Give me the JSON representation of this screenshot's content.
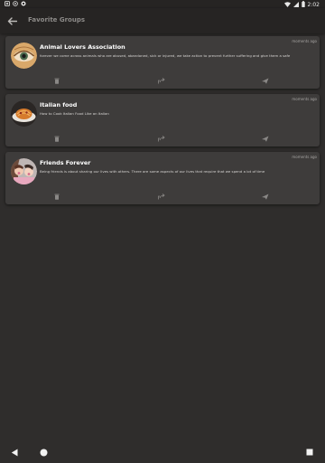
{
  "status_bar": {
    "time": "2:02",
    "left_icons": [
      "notification-x-icon",
      "settings-notification-icon",
      "circle-notification-icon"
    ],
    "right_icons": [
      "wifi-icon",
      "signal-icon",
      "battery-icon"
    ]
  },
  "app_bar": {
    "back_icon": "arrow-back-icon",
    "title": "Favorite Groups"
  },
  "groups": [
    {
      "title": "Animal Lovers Association",
      "description": "forever we come across animals who are abused, abandoned, sick or injured, we take action to prevent further suffering and give them a safe",
      "time": "moments ago",
      "avatar": "eye-avatar"
    },
    {
      "title": "Italian food",
      "description": "How to Cook Italian Food Like an Italian",
      "time": "moments ago",
      "avatar": "food-avatar"
    },
    {
      "title": "Friends Forever",
      "description": "Being friends is about sharing our lives with others. There are some aspects of our lives that require that we spend a lot of time",
      "time": "moments ago",
      "avatar": "friends-avatar"
    }
  ],
  "actions": {
    "delete_icon": "trash-icon",
    "share_icon": "share-icon",
    "send_icon": "send-icon"
  },
  "nav_bar": {
    "icons": [
      "nav-back-icon",
      "nav-home-icon",
      "nav-recent-icon"
    ]
  },
  "colors": {
    "background": "#2f2d2c",
    "app_bar": "#262423",
    "card": "#3e3c3b",
    "title_text": "#ffffff",
    "muted_text": "#8c8a88"
  }
}
